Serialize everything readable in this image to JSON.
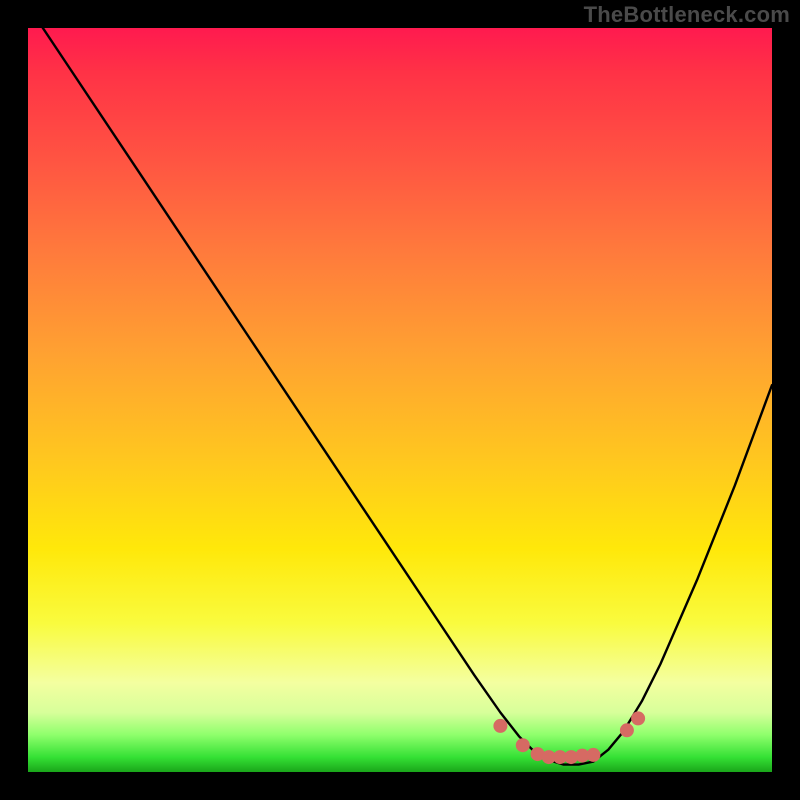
{
  "watermark": "TheBottleneck.com",
  "chart_data": {
    "type": "line",
    "title": "",
    "xlabel": "",
    "ylabel": "",
    "xlim": [
      0,
      100
    ],
    "ylim": [
      0,
      100
    ],
    "grid": false,
    "legend": false,
    "description": "Bottleneck percentage curve over a red-to-green vertical gradient. Black V-shaped curve descends from top-left to a minimum near x≈70 then rises toward the right edge. Marker dots sit along the valley floor.",
    "x": [
      0,
      5,
      10,
      15,
      20,
      25,
      30,
      35,
      40,
      45,
      50,
      55,
      60,
      63.5,
      66,
      68,
      70,
      72,
      74,
      76,
      78,
      80,
      82.5,
      85,
      90,
      95,
      100
    ],
    "values": [
      103,
      95.5,
      88,
      80.5,
      73,
      65.5,
      58,
      50.5,
      43,
      35.5,
      28,
      20.5,
      13,
      8,
      4.8,
      2.8,
      1.6,
      1,
      1,
      1.4,
      3,
      5.4,
      9.5,
      14.5,
      26,
      38.5,
      52
    ],
    "markers": {
      "color": "#d66a63",
      "points": [
        {
          "x": 63.5,
          "y": 6.2
        },
        {
          "x": 66.5,
          "y": 3.6
        },
        {
          "x": 68.5,
          "y": 2.4
        },
        {
          "x": 70.0,
          "y": 2.0
        },
        {
          "x": 71.5,
          "y": 2.0
        },
        {
          "x": 73.0,
          "y": 2.0
        },
        {
          "x": 74.5,
          "y": 2.2
        },
        {
          "x": 76.0,
          "y": 2.3
        },
        {
          "x": 80.5,
          "y": 5.6
        },
        {
          "x": 82.0,
          "y": 7.2
        }
      ]
    },
    "gradient_stops": [
      {
        "pos": 0,
        "color": "#ff1a4f"
      },
      {
        "pos": 18,
        "color": "#ff5542"
      },
      {
        "pos": 44,
        "color": "#ffa231"
      },
      {
        "pos": 70,
        "color": "#ffe80a"
      },
      {
        "pos": 88,
        "color": "#f4ffa0"
      },
      {
        "pos": 95,
        "color": "#8fff6c"
      },
      {
        "pos": 100,
        "color": "#1aa61a"
      }
    ]
  }
}
